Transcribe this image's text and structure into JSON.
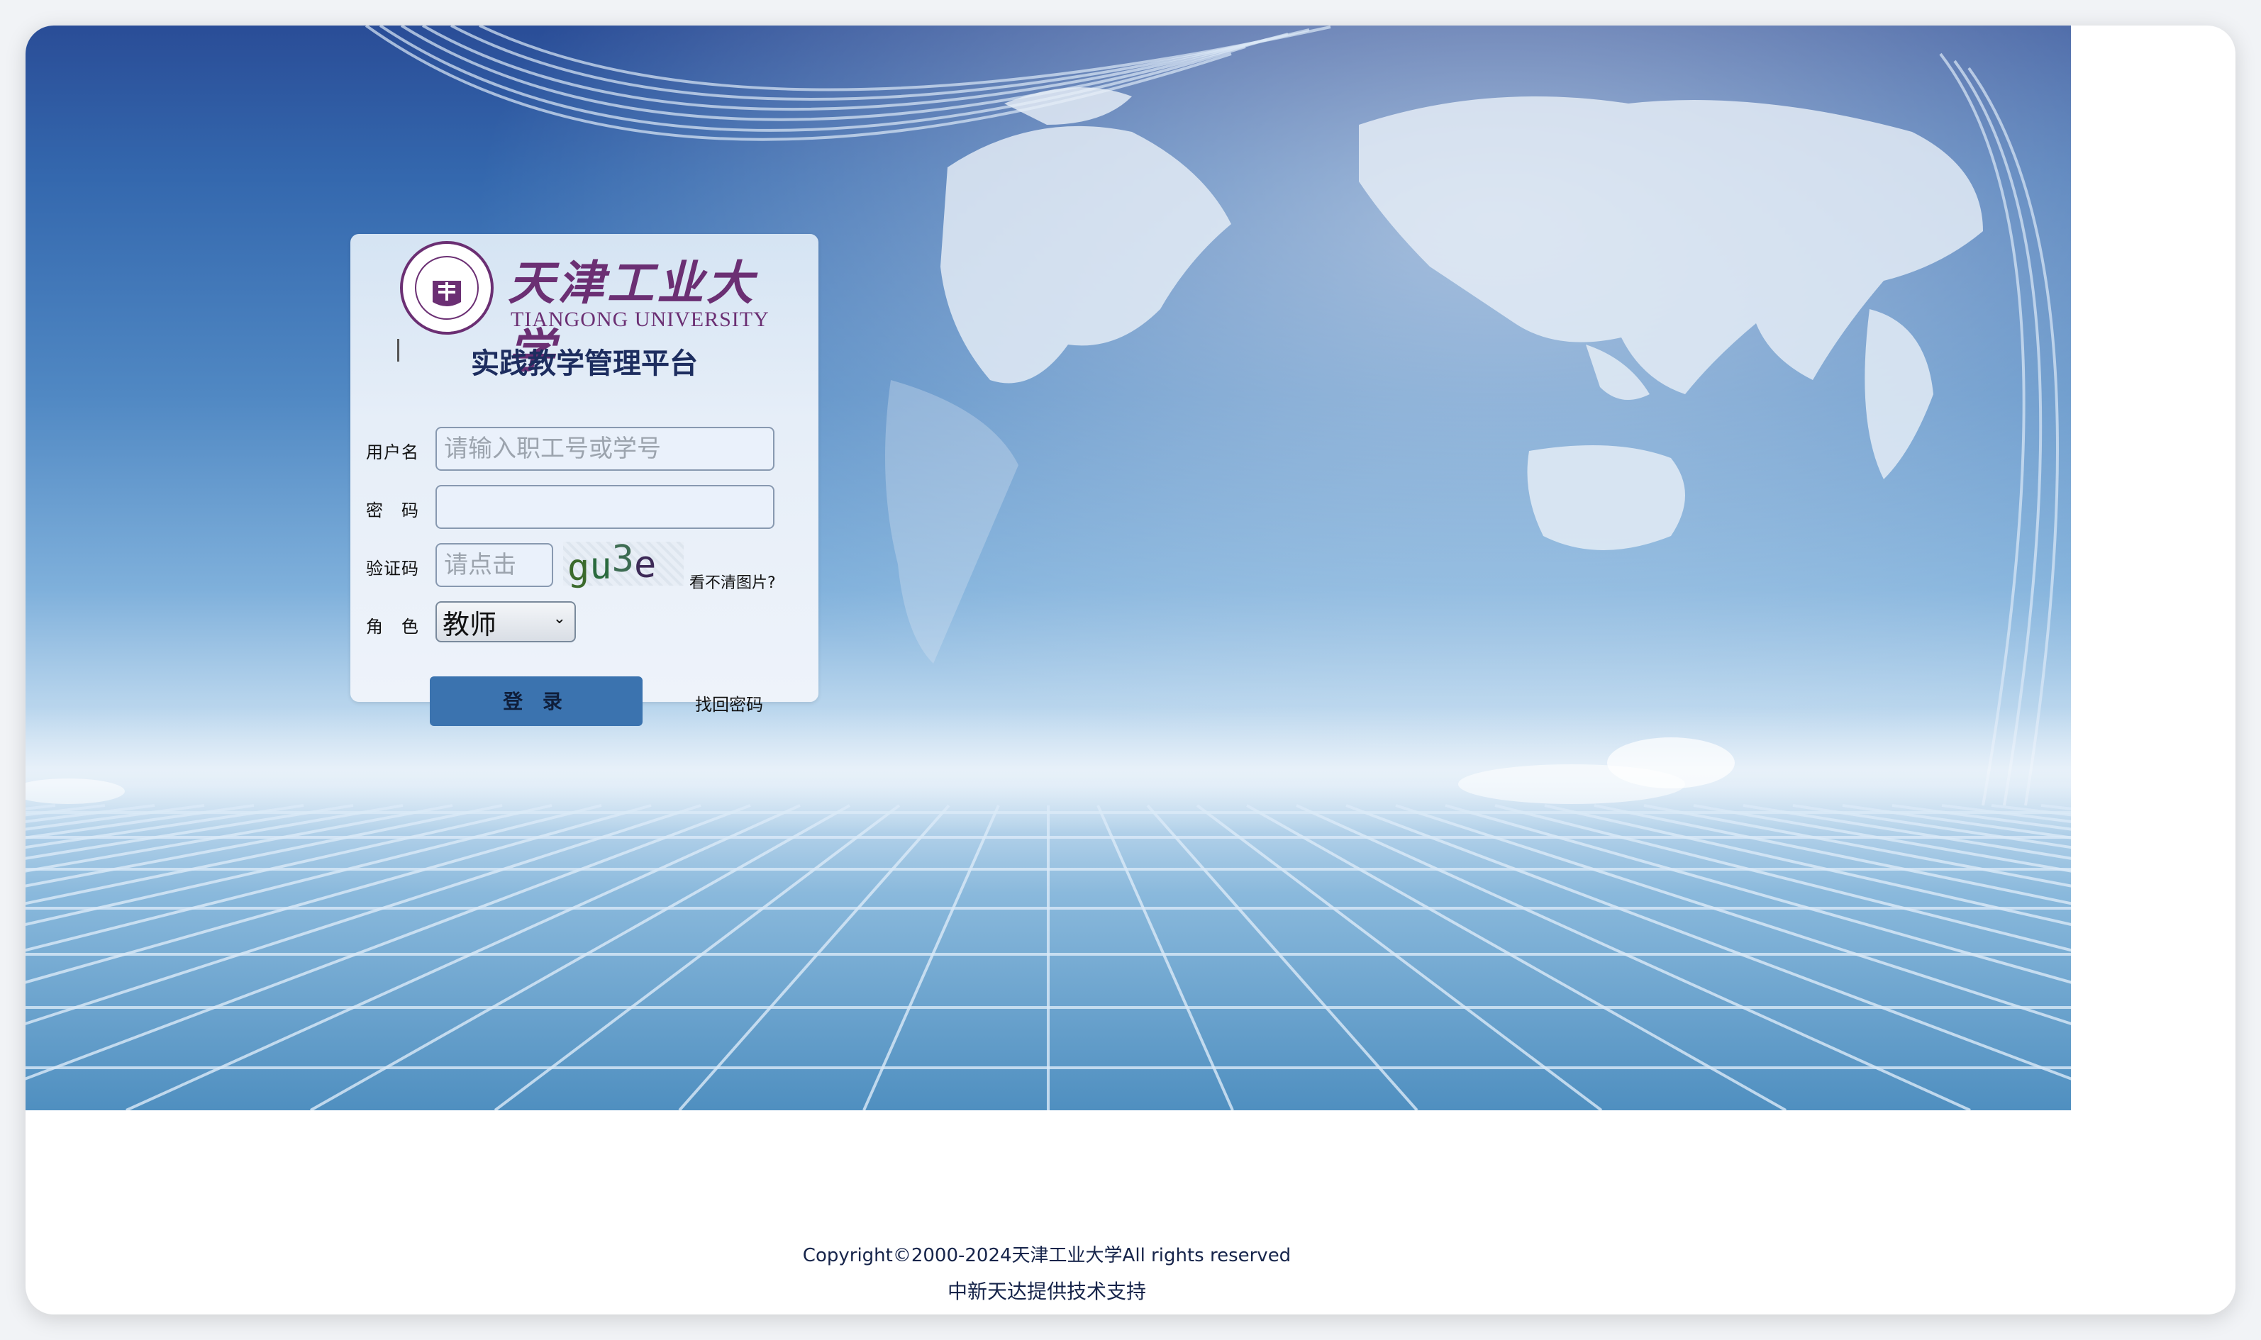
{
  "logo": {
    "cn_name": "天津工业大学",
    "en_name": "TIANGONG UNIVERSITY",
    "seal_text": "TIANGONG UNIVERSITY"
  },
  "login": {
    "title": "实践教学管理平台",
    "username_label": "用户名",
    "username_placeholder": "请输入职工号或学号",
    "username_value": "",
    "password_label": "密　码",
    "password_value": "",
    "captcha_label": "验证码",
    "captcha_placeholder": "请点击",
    "captcha_chars": [
      "g",
      "u",
      "3",
      "e"
    ],
    "captcha_colors": [
      "#3b6a2c",
      "#2a6a3e",
      "#3d6c52",
      "#3d2a57"
    ],
    "cant_see": "看不清图片?",
    "role_label": "角　色",
    "role_value": "教师",
    "login_button": "登 录",
    "forgot_link": "找回密码"
  },
  "footer": {
    "copyright": "Copyright©2000-2024天津工业大学All rights reserved",
    "support": "中新天达提供技术支持"
  },
  "colors": {
    "accent": "#3b73af",
    "brand_purple": "#6b2f73",
    "title_navy": "#1d2d5f"
  }
}
